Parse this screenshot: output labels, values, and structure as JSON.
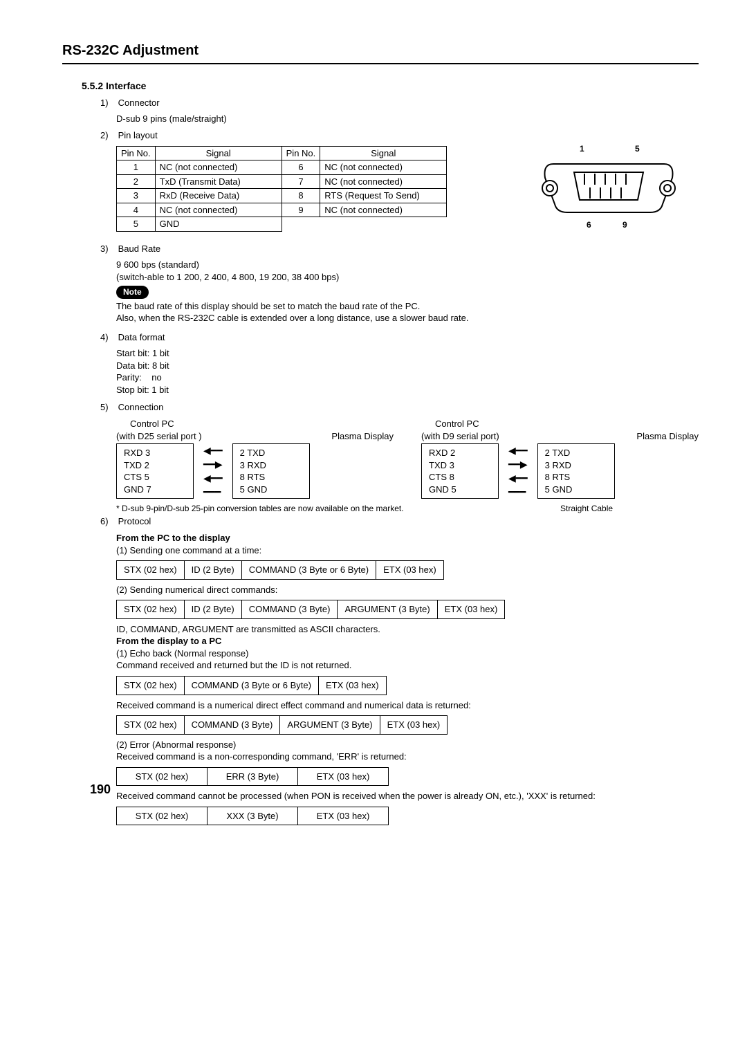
{
  "page_title": "RS-232C Adjustment",
  "section_heading": "5.5.2 Interface",
  "items": {
    "i1_num": "1)",
    "i1_label": "Connector",
    "i1_sub": "D-sub 9 pins (male/straight)",
    "i2_num": "2)",
    "i2_label": "Pin layout",
    "pins": {
      "h1": "Pin No.",
      "h2": "Signal",
      "h3": "Pin No.",
      "h4": "Signal",
      "r1a": "1",
      "r1b": "NC (not connected)",
      "r1c": "6",
      "r1d": "NC (not connected)",
      "r2a": "2",
      "r2b": "TxD (Transmit Data)",
      "r2c": "7",
      "r2d": "NC (not connected)",
      "r3a": "3",
      "r3b": "RxD (Receive Data)",
      "r3c": "8",
      "r3d": "RTS (Request To Send)",
      "r4a": "4",
      "r4b": "NC (not connected)",
      "r4c": "9",
      "r4d": "NC (not connected)",
      "r5a": "5",
      "r5b": "GND"
    },
    "conn_labels": {
      "l1": "1",
      "l5": "5",
      "l6": "6",
      "l9": "9"
    },
    "i3_num": "3)",
    "i3_label": "Baud Rate",
    "i3_sub1": "9 600 bps (standard)",
    "i3_sub2": "(switch-able to 1 200, 2 400, 4 800, 19 200, 38 400 bps)",
    "note_badge": "Note",
    "note_line1": "The baud rate of this display should be set to match the baud rate of the PC.",
    "note_line2": "Also, when the RS-232C cable is extended over a long distance, use a slower baud rate.",
    "i4_num": "4)",
    "i4_label": "Data format",
    "i4_s1": "Start bit: 1 bit",
    "i4_s2": "Data bit: 8 bit",
    "i4_s3": "Parity:    no",
    "i4_s4": "Stop bit: 1 bit",
    "i5_num": "5)",
    "i5_label": "Connection",
    "conn": {
      "left_title": "Control PC",
      "left_sub": "(with D25 serial port )",
      "left_pd": "Plasma Display",
      "left_box1_l1": "RXD 3",
      "left_box1_l2": "TXD 2",
      "left_box1_l3": "CTS 5",
      "left_box1_l4": "GND 7",
      "pd_l1": "2 TXD",
      "pd_l2": "3 RXD",
      "pd_l3": "8 RTS",
      "pd_l4": "5 GND",
      "right_title": "Control PC",
      "right_sub": "(with D9 serial port)",
      "right_pd": "Plasma Display",
      "right_box1_l1": "RXD 2",
      "right_box1_l2": "TXD 3",
      "right_box1_l3": "CTS 8",
      "right_box1_l4": "GND 5"
    },
    "conn_footnote": "*  D-sub 9-pin/D-sub 25-pin conversion tables are now  available on the market.",
    "straight_cable": "Straight Cable",
    "i6_num": "6)",
    "i6_label": "Protocol",
    "p_from_pc": "From the PC to the display",
    "p_send1": "(1) Sending one command at a time:",
    "tbl1": {
      "c1": "STX (02 hex)",
      "c2": "ID (2 Byte)",
      "c3": "COMMAND (3 Byte or 6 Byte)",
      "c4": "ETX (03 hex)"
    },
    "p_send2": "(2) Sending numerical direct commands:",
    "tbl2": {
      "c1": "STX (02 hex)",
      "c2": "ID (2 Byte)",
      "c3": "COMMAND (3 Byte)",
      "c4": "ARGUMENT (3 Byte)",
      "c5": "ETX (03 hex)"
    },
    "p_ascii": "ID, COMMAND, ARGUMENT are transmitted as ASCII characters.",
    "p_from_disp": "From the display to a PC",
    "p_echo": "(1) Echo back (Normal response)",
    "p_echo_sub": "Command received and returned but the ID is not returned.",
    "tbl3": {
      "c1": "STX (02 hex)",
      "c2": "COMMAND (3 Byte or 6 Byte)",
      "c3": "ETX (03 hex)"
    },
    "p_recv_num": "Received command is a numerical direct effect command and numerical data is returned:",
    "tbl4": {
      "c1": "STX (02 hex)",
      "c2": "COMMAND (3 Byte)",
      "c3": "ARGUMENT (3 Byte)",
      "c4": "ETX (03 hex)"
    },
    "p_err": "(2) Error (Abnormal response)",
    "p_err_sub": "Received command is a non-corresponding command, 'ERR' is returned:",
    "tbl5": {
      "c1": "STX (02 hex)",
      "c2": "ERR (3 Byte)",
      "c3": "ETX (03 hex)"
    },
    "p_xxx": "Received command cannot be processed (when PON is received when the power is already ON, etc.), 'XXX' is returned:",
    "tbl6": {
      "c1": "STX (02 hex)",
      "c2": "XXX (3 Byte)",
      "c3": "ETX (03 hex)"
    }
  },
  "page_number": "190"
}
